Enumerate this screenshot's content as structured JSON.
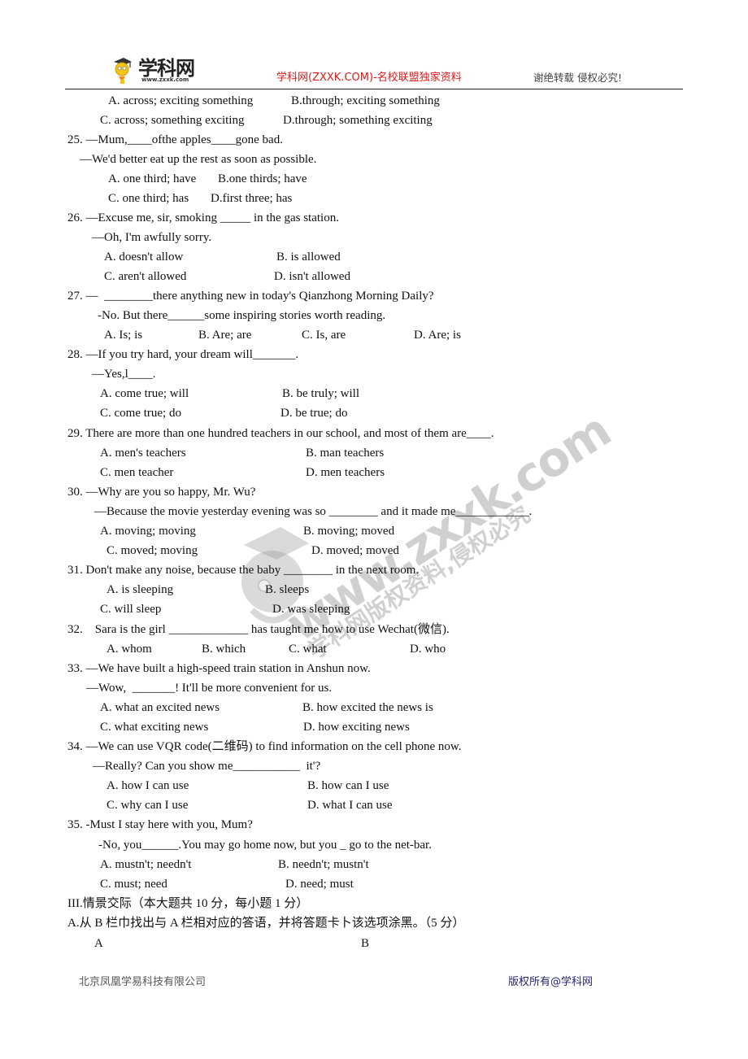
{
  "header": {
    "logo_text": "学科网",
    "logo_url": "www.zxxk.com",
    "center_text": "学科网(ZXXK.COM)-名校联盟独家资料",
    "right_text": "谢绝转载 侵权必究!",
    "center_color": "#e01818"
  },
  "lines": [
    "A. across; exciting something",
    "B.through; exciting something",
    "C. across; something exciting",
    "D.through; something exciting",
    "25. —Mum,____ofthe apples____gone bad.",
    "—We'd better eat up the rest as soon as possible.",
    "A. one third; have",
    "B.one thirds; have",
    "C. one third; has",
    "D.first three; has",
    "26. —Excuse me, sir, smoking _____ in the gas station.",
    "—Oh, I'm awfully sorry.",
    "A. doesn't allow",
    "B. is allowed",
    "C. aren't allowed",
    "D. isn't allowed",
    "27. —  ________there anything new in today's Qianzhong Morning Daily?",
    "-No. But there______some inspiring stories worth reading.",
    "A. Is; is",
    "B. Are; are",
    "C. Is, are",
    "D. Are; is",
    "28. —If you try hard, your dream will_______.",
    "—Yes,l____.",
    "A. come true; will",
    "B. be truly; will",
    "C. come true; do",
    "D. be true; do",
    "29. There are more than one hundred teachers in our school, and most of them are____.",
    "A. men's teachers",
    "B. man teachers",
    "C. men teacher",
    "D. men teachers",
    "30. —Why are you so happy, Mr. Wu?",
    "—Because the movie yesterday evening was so ________ and it made me____________.",
    "A. moving; moving",
    "B. moving; moved",
    "C. moved; moving",
    "D. moved; moved",
    "31. Don't make any noise, because the baby ________ in the next room.",
    "A. is sleeping",
    "B. sleeps",
    "C. will sleep",
    "D. was sleeping",
    "32.    Sara is the girl _____________ has taught me how to use Wechat(微信).",
    "A. whom",
    "B. which",
    "C. what",
    "D. who",
    "33. —We have built a high-speed train station in Anshun now.",
    "—Wow,  _______! It'll be more convenient for us.",
    "A. what an excited news",
    "B. how excited the news is",
    "C. what exciting news",
    "D. how exciting news",
    "34. —We can use VQR code(二维码) to find information on the cell phone now.",
    "—Really? Can you show me___________  it'?",
    "A. how I can use",
    "B. how can I use",
    "C. why can I use",
    "D. what I can use",
    "35. -Must I stay here with you, Mum?",
    "-No, you______.You may go home now, but you _ go to the net-bar.",
    "A. mustn't; needn't",
    "B. needn't; mustn't",
    "C. must; need",
    "D. need; must",
    "III.情景交际（本大题共 10 分，每小题 1 分）",
    "A.从 B 栏巾找出与 A 栏相对应的答语，并将答题卡卜该选项涂黑。（5 分）",
    "A",
    "B"
  ],
  "watermark": {
    "url_text": "www.zxxk.com",
    "slogan": "学科网版权资料,侵权必究"
  },
  "footer": {
    "left_text": "北京凤凰学易科技有限公司",
    "right_text": "版权所有@学科网"
  }
}
